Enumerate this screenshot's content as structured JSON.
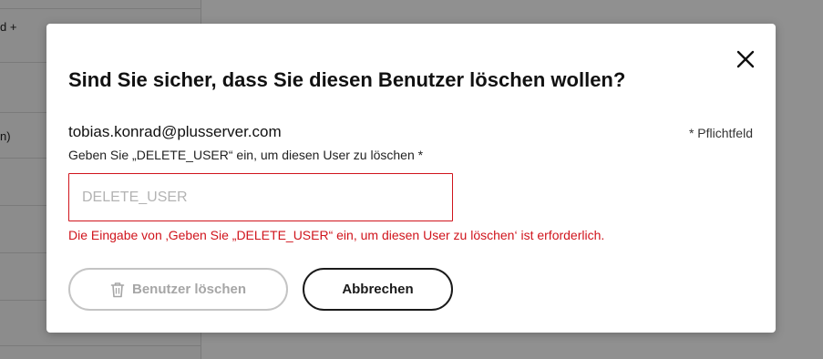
{
  "background": {
    "row_texts": [
      "d +",
      "n)"
    ]
  },
  "modal": {
    "title": "Sind Sie sicher, dass Sie diesen Benutzer löschen wollen?",
    "email": "tobias.konrad@plusserver.com",
    "required_note": "* Pflichtfeld",
    "field_label": "Geben Sie „DELETE_USER“ ein, um diesen User zu löschen *",
    "input": {
      "value": "",
      "placeholder": "DELETE_USER"
    },
    "error": "Die Eingabe von ‚Geben Sie „DELETE_USER“ ein, um diesen User zu löschen‘ ist erforderlich.",
    "buttons": {
      "delete_label": "Benutzer löschen",
      "cancel_label": "Abbrechen"
    },
    "icons": {
      "close": "close-icon",
      "delete": "trash-icon"
    }
  },
  "colors": {
    "error": "#d0141c",
    "disabled": "#a6a6a6",
    "primary_text": "#111111"
  }
}
